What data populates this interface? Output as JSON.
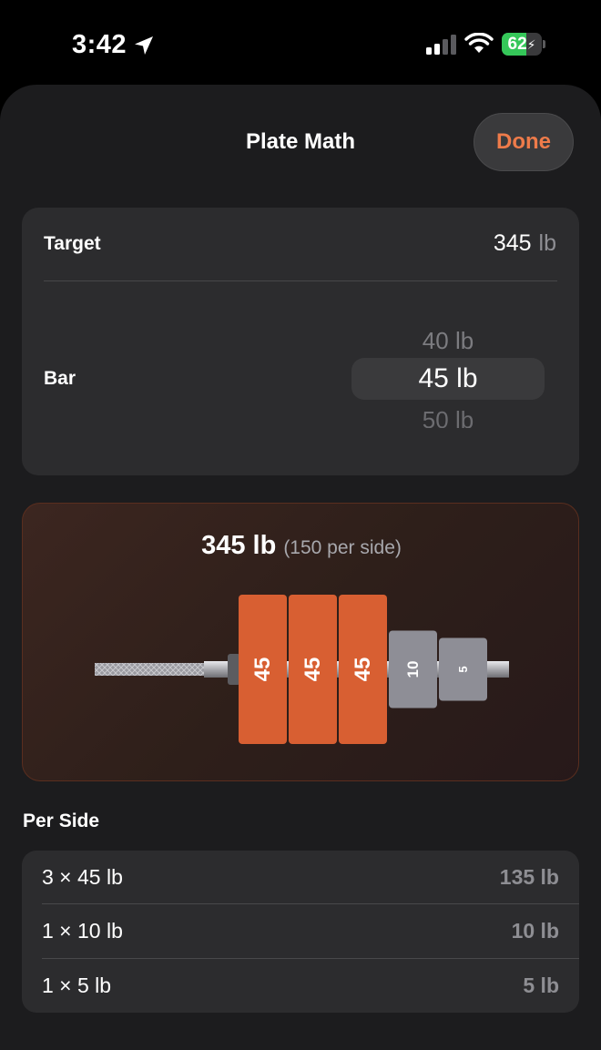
{
  "status": {
    "time": "3:42",
    "battery": "62",
    "battery_level_percent": 62
  },
  "sheet": {
    "title": "Plate Math",
    "done_label": "Done"
  },
  "settings": {
    "target_label": "Target",
    "target_value": "345",
    "target_unit": "lb",
    "bar_label": "Bar",
    "bar_options": [
      "40 lb",
      "45 lb",
      "50 lb"
    ],
    "bar_selected": "45 lb"
  },
  "visual": {
    "total": "345 lb",
    "per_side_note": "(150 per side)",
    "plates": [
      {
        "label": "45",
        "kind": "large"
      },
      {
        "label": "45",
        "kind": "large"
      },
      {
        "label": "45",
        "kind": "large"
      },
      {
        "label": "10",
        "kind": "medium"
      },
      {
        "label": "5",
        "kind": "small"
      }
    ],
    "colors": {
      "plate_45": "#d85f32",
      "plate_small": "#8e8e96",
      "accent": "#ee7b4a"
    }
  },
  "per_side": {
    "heading": "Per Side",
    "rows": [
      {
        "count": "3 × 45 lb",
        "total": "135 lb"
      },
      {
        "count": "1 × 10 lb",
        "total": "10 lb"
      },
      {
        "count": "1 × 5 lb",
        "total": "5 lb"
      }
    ]
  }
}
